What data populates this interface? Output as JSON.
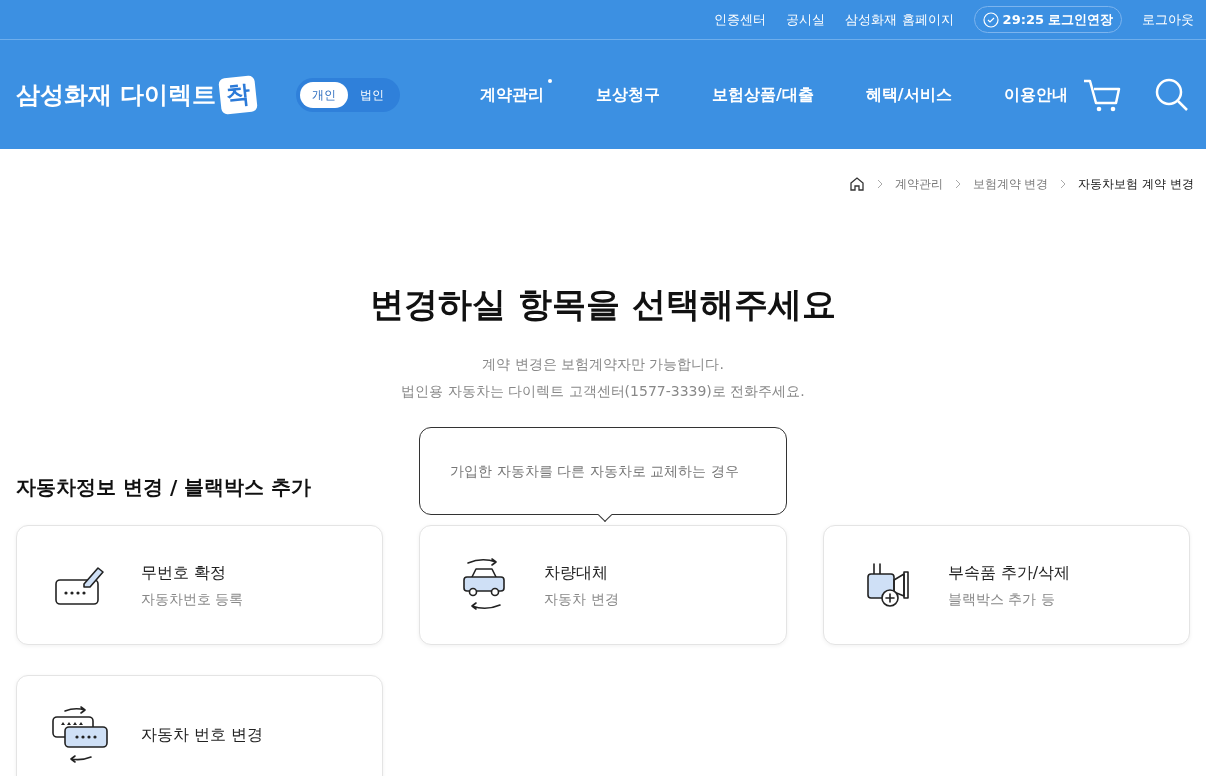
{
  "top_links": [
    "인증센터",
    "공시실",
    "삼성화재 홈페이지"
  ],
  "session": {
    "time": "29:25",
    "extend": "로그인연장"
  },
  "logout": "로그아웃",
  "logo": {
    "text": "삼성화재 다이렉트",
    "badge": "착"
  },
  "user_type": [
    {
      "label": "개인",
      "selected": true
    },
    {
      "label": "법인",
      "selected": false
    }
  ],
  "nav": [
    {
      "label": "계약관리",
      "new": true
    },
    {
      "label": "보상청구",
      "new": false
    },
    {
      "label": "보험상품/대출",
      "new": false
    },
    {
      "label": "혜택/서비스",
      "new": false
    },
    {
      "label": "이용안내",
      "new": false
    }
  ],
  "breadcrumb": [
    "계약관리",
    "보험계약 변경",
    "자동차보험 계약 변경"
  ],
  "title": "변경하실 항목을 선택해주세요",
  "notes": [
    "계약 변경은 보험계약자만 가능합니다.",
    "법인용 자동차는 다이렉트 고객센터(1577-3339)로 전화주세요."
  ],
  "section": "자동차정보 변경 / 블랙박스 추가",
  "cards": [
    {
      "kind": "plate-edit",
      "title": "무번호 확정",
      "subtitle": "자동차번호 등록"
    },
    {
      "kind": "car-swap",
      "title": "차량대체",
      "subtitle": "자동차 변경",
      "tooltip": "가입한 자동차를 다른 자동차로 교체하는 경우"
    },
    {
      "kind": "accessory",
      "title": "부속품 추가/삭제",
      "subtitle": "블랙박스 추가 등"
    },
    {
      "kind": "plate-swap",
      "title": "자동차 번호 변경"
    }
  ]
}
